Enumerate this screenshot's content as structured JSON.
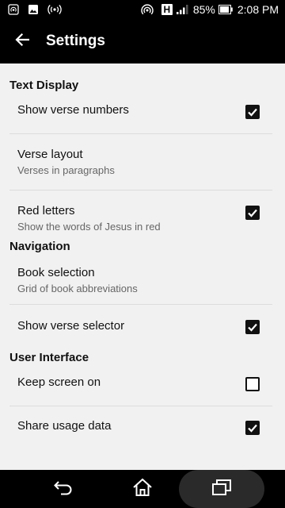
{
  "status_bar": {
    "battery": "85%",
    "time": "2:08 PM",
    "network_type": "H",
    "icons_left": [
      "hotspot-icon",
      "image-icon",
      "cast-icon"
    ],
    "icons_right": [
      "hotspot-icon",
      "network-type-icon",
      "signal-icon",
      "battery-icon"
    ]
  },
  "toolbar": {
    "title": "Settings",
    "back_icon": "arrow-left-icon"
  },
  "categories": {
    "text_display": "Text Display",
    "navigation": "Navigation",
    "user_interface": "User Interface"
  },
  "prefs": {
    "show_verse_numbers": {
      "title": "Show verse numbers",
      "checked": true
    },
    "verse_layout": {
      "title": "Verse layout",
      "summary": "Verses in paragraphs"
    },
    "red_letters": {
      "title": "Red letters",
      "summary": "Show the words of Jesus in red",
      "checked": true
    },
    "book_selection": {
      "title": "Book selection",
      "summary": "Grid of book abbreviations"
    },
    "show_verse_selector": {
      "title": "Show verse selector",
      "checked": true
    },
    "keep_screen_on": {
      "title": "Keep screen on",
      "checked": false
    },
    "share_usage_data": {
      "title": "Share usage data",
      "checked": true
    }
  },
  "nav_bar": {
    "icons": [
      "back-icon",
      "home-icon",
      "recents-icon"
    ]
  },
  "colors": {
    "bar_background": "#000000",
    "content_background": "#f1f1f1",
    "checkbox_checked": "#111111"
  }
}
